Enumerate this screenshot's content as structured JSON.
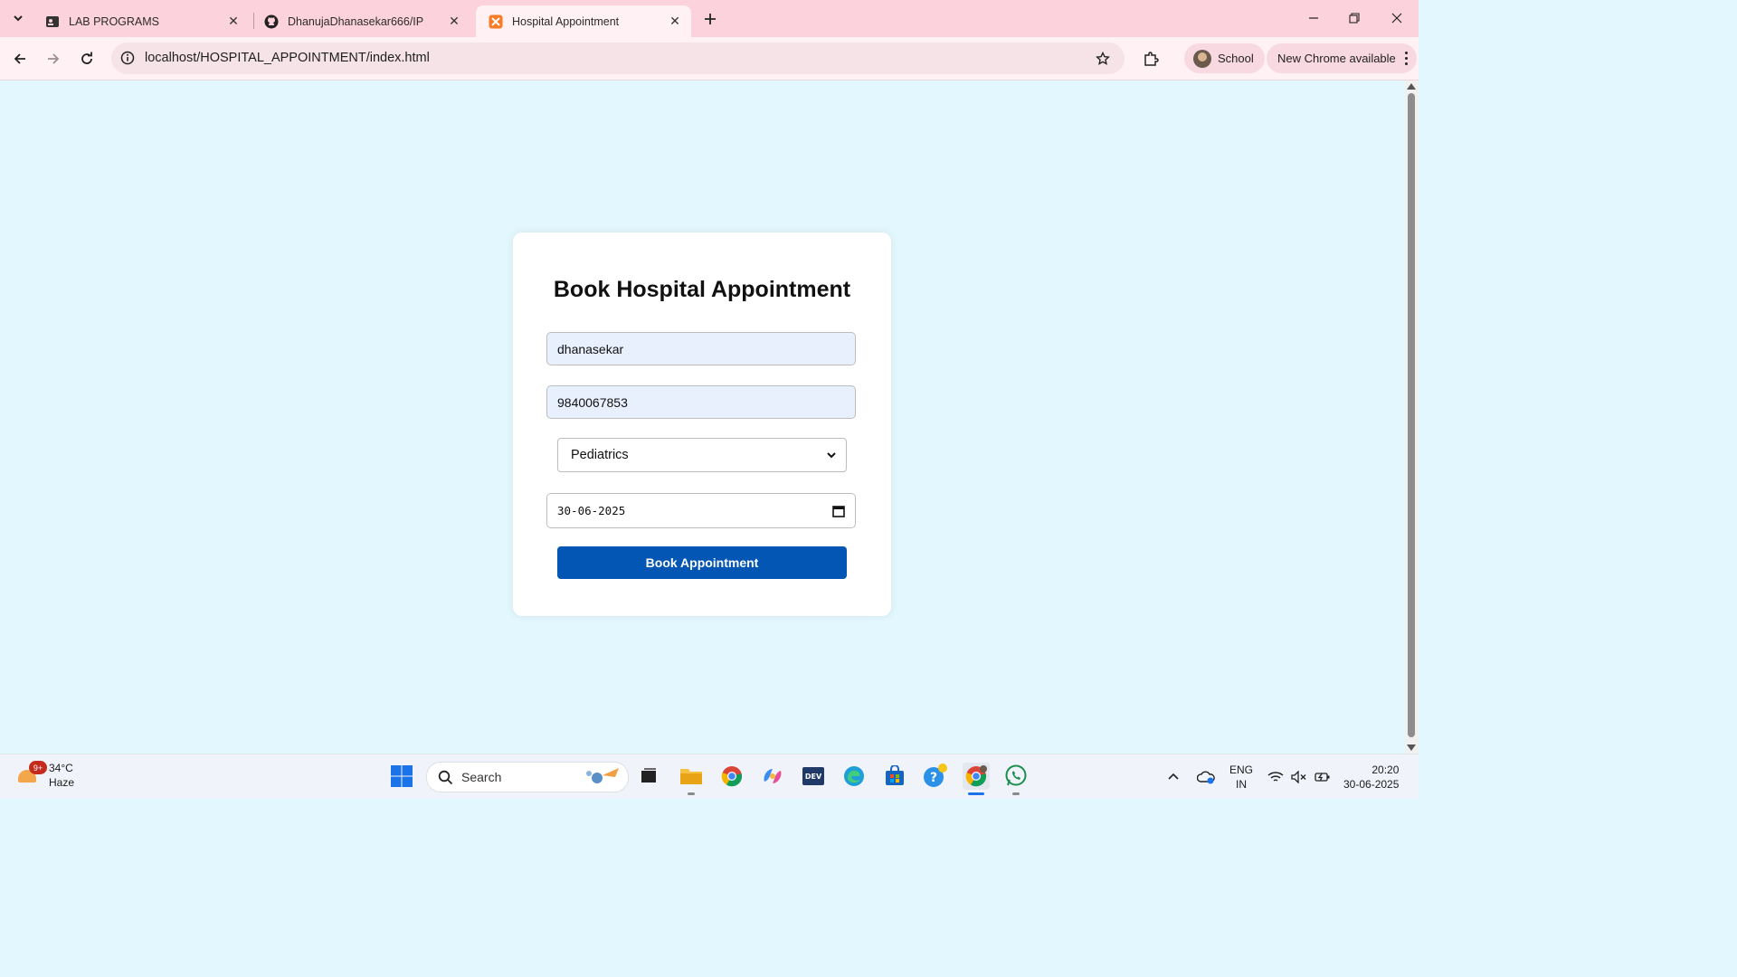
{
  "browser": {
    "tabs": [
      {
        "title": "LAB PROGRAMS",
        "icon": "person-card-icon",
        "active": false
      },
      {
        "title": "DhanujaDhanasekar666/IP",
        "icon": "github-icon",
        "active": false
      },
      {
        "title": "Hospital Appointment",
        "icon": "xampp-icon",
        "active": true
      }
    ],
    "url": "localhost/HOSPITAL_APPOINTMENT/index.html",
    "profile_label": "School",
    "update_label": "New Chrome available"
  },
  "form": {
    "title": "Book Hospital Appointment",
    "name_value": "dhanasekar",
    "phone_value": "9840067853",
    "department_selected": "Pediatrics",
    "date_value": "30-06-2025",
    "submit_label": "Book Appointment"
  },
  "taskbar": {
    "weather_temp": "34°C",
    "weather_desc": "Haze",
    "weather_badge": "9+",
    "search_label": "Search",
    "lang_line1": "ENG",
    "lang_line2": "IN",
    "time": "20:20",
    "date": "30-06-2025"
  },
  "colors": {
    "page_background": "#e3f7fe",
    "button": "#0356b3",
    "tabstrip": "#fcd2dd",
    "autofill": "#e8f0fe"
  }
}
